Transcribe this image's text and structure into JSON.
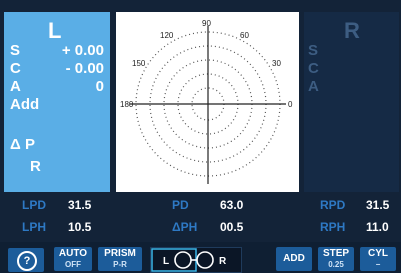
{
  "left_panel": {
    "letter": "L",
    "rows": [
      {
        "label": "S",
        "value": "+ 0.00"
      },
      {
        "label": "C",
        "value": "- 0.00"
      },
      {
        "label": "A",
        "value": "0"
      },
      {
        "label": "Add",
        "value": ""
      },
      {
        "label": "Δ P",
        "value": ""
      },
      {
        "label": "R",
        "value": ""
      }
    ]
  },
  "axis_chart": {
    "labels": [
      "90",
      "120",
      "60",
      "150",
      "30",
      "180",
      "0"
    ]
  },
  "right_panel": {
    "letter": "R",
    "labels": [
      "S",
      "C",
      "A"
    ]
  },
  "measurements": {
    "lpd_label": "LPD",
    "lpd_value": "31.5",
    "lph_label": "LPH",
    "lph_value": "10.5",
    "pd_label": "PD",
    "pd_value": "63.0",
    "dph_label": "ΔPH",
    "dph_value": "00.5",
    "rpd_label": "RPD",
    "rpd_value": "31.5",
    "rph_label": "RPH",
    "rph_value": "11.0"
  },
  "toolbar": {
    "help": "?",
    "auto_line1": "AUTO",
    "auto_line2": "OFF",
    "prism_line1": "PRISM",
    "prism_line2": "P-R",
    "lens_left": "L",
    "lens_right": "R",
    "add": "ADD",
    "step_line1": "STEP",
    "step_line2": "0.25",
    "cyl_line1": "CYL",
    "cyl_line2": "−"
  },
  "colors": {
    "panel_active": "#5aaee6",
    "panel_inactive": "#152a45",
    "label_blue": "#2e79c4",
    "button_blue": "#1c5c9a"
  }
}
